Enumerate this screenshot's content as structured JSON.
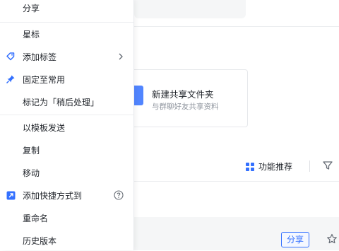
{
  "menu": {
    "items": [
      {
        "label": "分享",
        "icon": "none"
      },
      {
        "label": "星标",
        "icon": "none"
      },
      {
        "label": "添加标签",
        "icon": "tag-icon",
        "trail": "chevron-right-icon"
      },
      {
        "label": "固定至常用",
        "icon": "pin-icon"
      },
      {
        "label": "标记为「稍后处理」",
        "icon": "none"
      },
      {
        "label": "以模板发送",
        "icon": "none"
      },
      {
        "label": "复制",
        "icon": "none"
      },
      {
        "label": "移动",
        "icon": "none"
      },
      {
        "label": "添加快捷方式到",
        "icon": "shortcut-icon",
        "trail": "help-circle-icon"
      },
      {
        "label": "重命名",
        "icon": "none"
      },
      {
        "label": "历史版本",
        "icon": "none"
      }
    ]
  },
  "card": {
    "title": "新建共享文件夹",
    "subtitle": "与群聊好友共享资料"
  },
  "toolbar": {
    "function_recommend": "功能推荐"
  },
  "row": {
    "share_label": "分享"
  },
  "colors": {
    "accent": "#3370ff",
    "text": "#1f2329",
    "muted": "#8f959e"
  }
}
